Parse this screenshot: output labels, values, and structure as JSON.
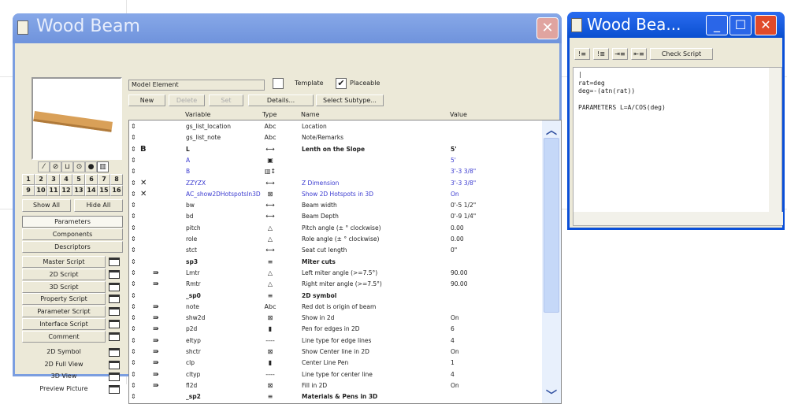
{
  "main_window": {
    "title": "Wood Beam",
    "view_icons": [
      "edit-icon",
      "plan-icon",
      "monitor-icon",
      "3d-icon",
      "shaded-icon",
      "section-icon"
    ],
    "numbers": [
      "1",
      "2",
      "3",
      "4",
      "5",
      "6",
      "7",
      "8",
      "9",
      "10",
      "11",
      "12",
      "13",
      "14",
      "15",
      "16"
    ],
    "show_all": "Show All",
    "hide_all": "Hide All",
    "sections": [
      "Parameters",
      "Components",
      "Descriptors"
    ],
    "scripts": [
      "Master Script",
      "2D Script",
      "3D Script",
      "Property Script",
      "Parameter Script",
      "Interface Script",
      "Comment"
    ],
    "views": [
      "2D Symbol",
      "2D Full View",
      "3D View",
      "Preview Picture"
    ],
    "subtype": "Model Element",
    "template_label": "Template",
    "template_checked": false,
    "placeable_label": "Placeable",
    "placeable_checked": true,
    "buttons": {
      "new": "New",
      "delete": "Delete",
      "set": "Set",
      "details": "Details...",
      "select_subtype": "Select Subtype..."
    },
    "columns": {
      "variable": "Variable",
      "type": "Type",
      "name": "Name",
      "value": "Value"
    },
    "rows": [
      {
        "mark": "",
        "var": "gs_list_location",
        "type": "Abc",
        "name": "Location",
        "value": "",
        "style": ""
      },
      {
        "mark": "",
        "var": "gs_list_note",
        "type": "Abc",
        "name": "Note/Remarks",
        "value": "",
        "style": ""
      },
      {
        "mark": "B",
        "var": "L",
        "type": "⟷",
        "name": "Lenth on the Slope",
        "value": "5'",
        "style": "bold"
      },
      {
        "mark": "",
        "var": "A",
        "type": "▣",
        "name": "",
        "value": "5'",
        "style": "blue"
      },
      {
        "mark": "",
        "var": "B",
        "type": "▥↕",
        "name": "",
        "value": "3'-3 3/8\"",
        "style": "blue"
      },
      {
        "mark": "✕",
        "var": "ZZYZX",
        "type": "⟷",
        "name": "Z Dimension",
        "value": "3'-3 3/8\"",
        "style": "blue"
      },
      {
        "mark": "✕",
        "var": "AC_show2DHotspotsIn3D",
        "type": "⊠",
        "name": "Show 2D Hotspots in 3D",
        "value": "On",
        "style": "blue"
      },
      {
        "mark": "",
        "var": "bw",
        "type": "⟷",
        "name": "Beam width",
        "value": "0'-5 1/2\"",
        "style": ""
      },
      {
        "mark": "",
        "var": "bd",
        "type": "⟷",
        "name": "Beam Depth",
        "value": "0'-9 1/4\"",
        "style": ""
      },
      {
        "mark": "",
        "var": "pitch",
        "type": "△",
        "name": "Pitch angle (±  ° clockwise)",
        "value": "0.00",
        "style": ""
      },
      {
        "mark": "",
        "var": "role",
        "type": "△",
        "name": "Role angle (±  ° clockwise)",
        "value": "0.00",
        "style": ""
      },
      {
        "mark": "",
        "var": "stct",
        "type": "⟷",
        "name": "Seat cut length",
        "value": "0\"",
        "style": ""
      },
      {
        "mark": "",
        "var": "sp3",
        "type": "≡",
        "name": "Miter cuts",
        "value": "",
        "style": "bold"
      },
      {
        "mark": "⇛",
        "var": "Lmtr",
        "type": "△",
        "name": "Left miter angle (>=7.5°)",
        "value": "90.00",
        "style": ""
      },
      {
        "mark": "⇛",
        "var": "Rmtr",
        "type": "△",
        "name": "Right miter angle (>=7.5°)",
        "value": "90.00",
        "style": ""
      },
      {
        "mark": "",
        "var": "_sp0",
        "type": "≡",
        "name": "2D symbol",
        "value": "",
        "style": "bold"
      },
      {
        "mark": "⇛",
        "var": "note",
        "type": "Abc",
        "name": "Red dot is origin of beam",
        "value": "",
        "style": ""
      },
      {
        "mark": "⇛",
        "var": "shw2d",
        "type": "⊠",
        "name": "Show in 2d",
        "value": "On",
        "style": ""
      },
      {
        "mark": "⇛",
        "var": "p2d",
        "type": "▮",
        "name": "Pen for edges in 2D",
        "value": "6",
        "style": ""
      },
      {
        "mark": "⇛",
        "var": "eltyp",
        "type": "----",
        "name": "Line type for edge lines",
        "value": "4",
        "style": ""
      },
      {
        "mark": "⇛",
        "var": "shctr",
        "type": "⊠",
        "name": "Show Center line in 2D",
        "value": "On",
        "style": ""
      },
      {
        "mark": "⇛",
        "var": "clp",
        "type": "▮",
        "name": "Center Line Pen",
        "value": "1",
        "style": ""
      },
      {
        "mark": "⇛",
        "var": "cltyp",
        "type": "----",
        "name": "Line type for center line",
        "value": "4",
        "style": ""
      },
      {
        "mark": "⇛",
        "var": "fl2d",
        "type": "⊠",
        "name": "Fill in 2D",
        "value": "On",
        "style": ""
      },
      {
        "mark": "",
        "var": "_sp2",
        "type": "≡",
        "name": "Materials & Pens in 3D",
        "value": "",
        "style": "bold"
      }
    ]
  },
  "script_window": {
    "title": "Wood Bea...",
    "check_script": "Check Script",
    "code": "|\nrat=deg\ndeg=-(atn(rat))\n\nPARAMETERS L=A/COS(deg)"
  },
  "colors": {
    "main_title_bar": "#7b9ee0",
    "active_title_bar": "#0a4fd8",
    "window_bg": "#ece9d8",
    "param_blue": "#3a3ad0",
    "close": "#e04a2a"
  }
}
